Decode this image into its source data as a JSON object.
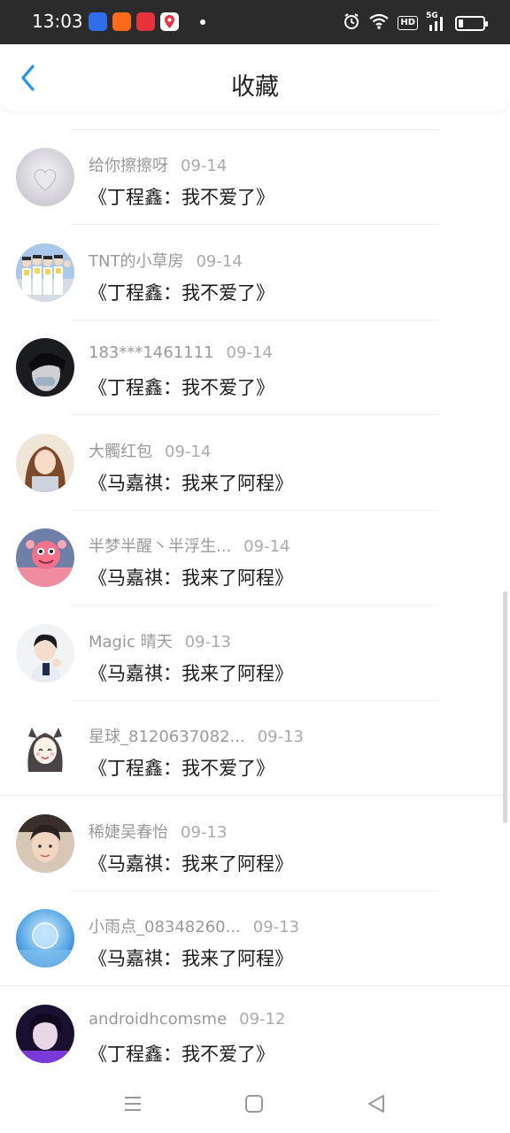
{
  "status_bar": {
    "time": "13:03",
    "hd": "HD",
    "network": "5G",
    "battery_level": 0.2,
    "notification_icons": [
      {
        "name": "baidu-app-icon",
        "color": "#2f6ee8"
      },
      {
        "name": "orange-app-icon",
        "color": "#ff6a1a"
      },
      {
        "name": "red-app-icon",
        "color": "#e8323c"
      },
      {
        "name": "map-pin-app-icon",
        "color": "#1e7ef0"
      }
    ]
  },
  "header": {
    "title": "收藏"
  },
  "colors": {
    "accent": "#2196f3",
    "title_text": "#1a1a1a",
    "meta_text": "#999999"
  },
  "items": [
    {
      "user": "给你擦擦呀",
      "date": "09-14",
      "title": "《丁程鑫：我不爱了》",
      "avatar": "heart-avatar"
    },
    {
      "user": "TNT的小草房",
      "date": "09-14",
      "title": "《丁程鑫：我不爱了》",
      "avatar": "group-photo-avatar"
    },
    {
      "user": "183***1461111",
      "date": "09-14",
      "title": "《丁程鑫：我不爱了》",
      "avatar": "dark-portrait-avatar"
    },
    {
      "user": "大髑红包",
      "date": "09-14",
      "title": "《马嘉祺：我来了阿程》",
      "avatar": "girl-portrait-avatar"
    },
    {
      "user": "半梦半醒丶半浮生...",
      "date": "09-14",
      "title": "《马嘉祺：我来了阿程》",
      "avatar": "cartoon-avatar"
    },
    {
      "user": "Magic 晴天",
      "date": "09-13",
      "title": "《马嘉祺：我来了阿程》",
      "avatar": "boy-portrait-avatar"
    },
    {
      "user": "星球_8120637082...",
      "date": "09-13",
      "title": "《丁程鑫：我不爱了》",
      "avatar": "anime-girl-avatar"
    },
    {
      "user": "稀婕吴春怡",
      "date": "09-13",
      "title": "《马嘉祺：我来了阿程》",
      "avatar": "boy-selfie-avatar"
    },
    {
      "user": "小雨点_08348260...",
      "date": "09-13",
      "title": "《马嘉祺：我来了阿程》",
      "avatar": "blue-globe-avatar"
    },
    {
      "user": "androidhcomsme",
      "date": "09-12",
      "title": "《丁程鑫：我不爱了》",
      "avatar": "purple-portrait-avatar"
    }
  ],
  "nav_bar": {
    "buttons": [
      "menu-icon",
      "home-square-icon",
      "back-triangle-icon"
    ]
  }
}
